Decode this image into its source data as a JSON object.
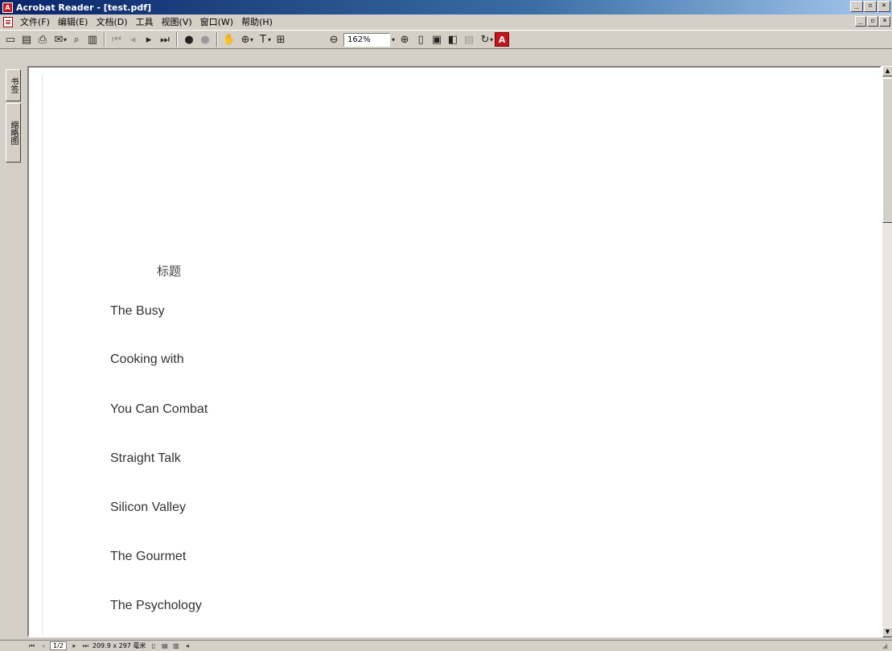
{
  "window": {
    "title": "Acrobat Reader - [test.pdf]",
    "app_icon": "acrobat-icon",
    "controls": {
      "minimize": "_",
      "maximize": "▫",
      "close": "×"
    },
    "mdi_controls": {
      "minimize": "_",
      "restore": "▫",
      "close": "×"
    }
  },
  "menu": {
    "items": [
      "文件(F)",
      "编辑(E)",
      "文档(D)",
      "工具",
      "视图(V)",
      "窗口(W)",
      "帮助(H)"
    ]
  },
  "toolbar": {
    "zoom": "162%",
    "icons": [
      "open-icon",
      "save-icon",
      "print-icon",
      "email-icon",
      "search-icon",
      "bookmark-icon",
      "first-page-icon",
      "prev-page-icon",
      "next-page-icon",
      "last-page-icon",
      "go-back-icon",
      "go-forward-icon",
      "hand-tool-icon",
      "zoom-tool-icon",
      "select-text-icon",
      "snapshot-icon",
      "zoom-out-icon",
      "zoom-in-icon",
      "actual-size-icon",
      "fit-page-icon",
      "fit-width-icon",
      "reflow-icon",
      "rotate-icon",
      "adobe-icon"
    ]
  },
  "left_panel": {
    "tabs": [
      "书签",
      "缩略图"
    ]
  },
  "document": {
    "title": "标题",
    "lines": [
      "The Busy",
      "Cooking with",
      "You Can Combat",
      "Straight Talk",
      "Silicon Valley",
      "The Gourmet",
      "The Psychology"
    ]
  },
  "statusbar": {
    "page": "1/2",
    "page_size": "209.9 x 297 毫米"
  }
}
